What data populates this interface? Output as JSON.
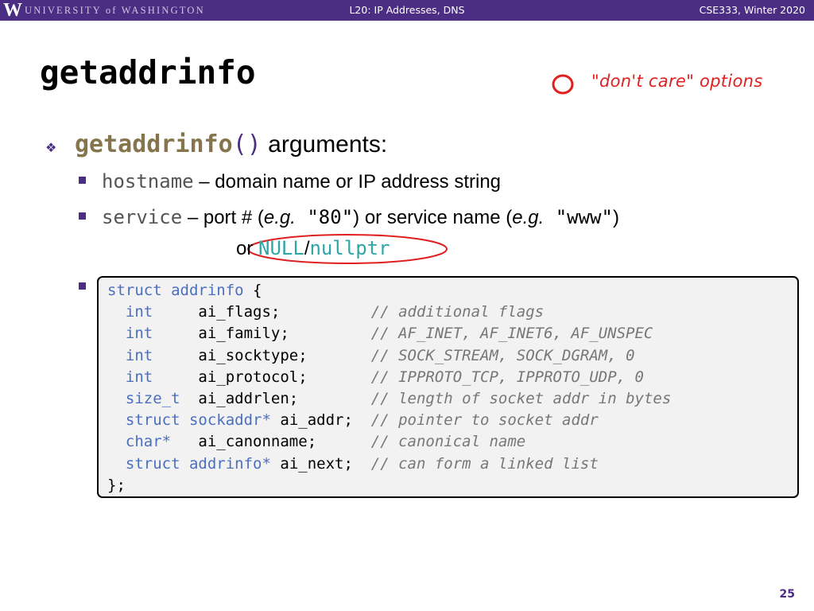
{
  "header": {
    "logo": "W",
    "university": "UNIVERSITY of WASHINGTON",
    "lecture": "L20: IP Addresses, DNS",
    "course": "CSE333, Winter 2020"
  },
  "title": "getaddrinfo",
  "annotation": {
    "legend_text": "\"don't care\" options",
    "color": "#e02020"
  },
  "bullets": {
    "main": {
      "function_name": "getaddrinfo",
      "parens": "()",
      "suffix": " arguments:"
    },
    "hostname": {
      "name": "hostname",
      "description": " – domain name or IP address string"
    },
    "service": {
      "name": "service",
      "desc_part1": " – port # (",
      "eg1": "e.g.",
      "value1": " \"80\"",
      "desc_part2": ") or service name (",
      "eg2": "e.g.",
      "value2": " \"www\"",
      "desc_part3": ")",
      "or_text": "or ",
      "null_text": "NULL",
      "slash": "/",
      "nullptr_text": "nullptr"
    }
  },
  "code": {
    "line0_kw": "struct addrinfo",
    "line0_rest": " {",
    "fields": [
      {
        "type": "int",
        "pad": "     ",
        "name": "ai_flags;",
        "gap": "          ",
        "comment": "// additional flags"
      },
      {
        "type": "int",
        "pad": "     ",
        "name": "ai_family;",
        "gap": "         ",
        "comment": "// AF_INET, AF_INET6, AF_UNSPEC"
      },
      {
        "type": "int",
        "pad": "     ",
        "name": "ai_socktype;",
        "gap": "       ",
        "comment": "// SOCK_STREAM, SOCK_DGRAM, 0"
      },
      {
        "type": "int",
        "pad": "     ",
        "name": "ai_protocol;",
        "gap": "       ",
        "comment": "// IPPROTO_TCP, IPPROTO_UDP, 0"
      },
      {
        "type": "size_t",
        "pad": "  ",
        "name": "ai_addrlen;",
        "gap": "        ",
        "comment": "// length of socket addr in bytes"
      },
      {
        "type": "struct sockaddr*",
        "pad": " ",
        "name": "ai_addr;",
        "gap": "  ",
        "comment": "// pointer to socket addr"
      },
      {
        "type": "char*",
        "pad": "   ",
        "name": "ai_canonname;",
        "gap": "      ",
        "comment": "// canonical name"
      },
      {
        "type": "struct addrinfo*",
        "pad": " ",
        "name": "ai_next;",
        "gap": "  ",
        "comment": "// can form a linked list"
      }
    ],
    "closing": "};"
  },
  "page_number": "25",
  "colors": {
    "header_bg": "#4b2e83",
    "function_gold": "#85754d",
    "teal": "#2ea6a6",
    "code_keyword": "#4b6fbf",
    "annotation_red": "#e02020"
  }
}
